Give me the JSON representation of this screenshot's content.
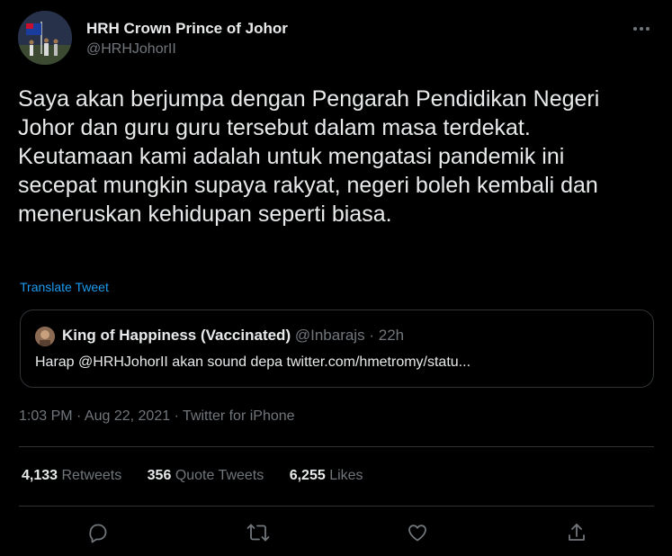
{
  "author": {
    "name": "HRH Crown Prince of Johor",
    "handle": "@HRHJohorII"
  },
  "tweet": {
    "text": "Saya akan berjumpa dengan Pengarah Pendidikan Negeri Johor dan guru guru tersebut dalam masa terdekat. Keutamaan kami adalah untuk mengatasi pandemik ini secepat mungkin supaya rakyat, negeri boleh kembali dan meneruskan kehidupan seperti biasa.",
    "translate_label": "Translate Tweet"
  },
  "quoted_tweet": {
    "name": "King of Happiness (Vaccinated)",
    "handle": "@Inbarajs",
    "separator": "·",
    "time": "22h",
    "text": "Harap @HRHJohorII akan sound depa twitter.com/hmetromy/statu..."
  },
  "meta": {
    "text": "1:03 PM · Aug 22, 2021 · Twitter for iPhone"
  },
  "stats": {
    "retweets": {
      "count": "4,133",
      "label": "Retweets"
    },
    "quote_tweets": {
      "count": "356",
      "label": "Quote Tweets"
    },
    "likes": {
      "count": "6,255",
      "label": "Likes"
    }
  },
  "icons": {
    "more": "more-icon",
    "reply": "reply-icon",
    "retweet": "retweet-icon",
    "like": "like-icon",
    "share": "share-icon"
  },
  "colors": {
    "background": "#000000",
    "text": "#e7e9ea",
    "secondary": "#71767b",
    "link": "#1d9bf0",
    "border": "#2f3336"
  }
}
